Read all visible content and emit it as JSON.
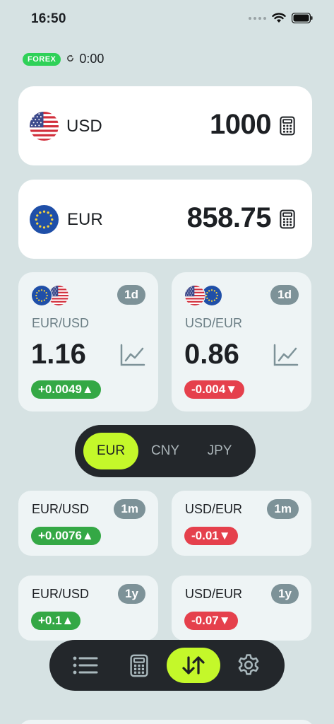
{
  "status_bar": {
    "time": "16:50"
  },
  "source": {
    "badge": "FOREX",
    "timer": "0:00"
  },
  "converter": {
    "from": {
      "code": "USD",
      "amount": "1000"
    },
    "to": {
      "code": "EUR",
      "amount": "858.75"
    }
  },
  "rate_cards": [
    {
      "pair": "EUR/USD",
      "period": "1d",
      "rate": "1.16",
      "change": "+0.0049▲",
      "direction": "up"
    },
    {
      "pair": "USD/EUR",
      "period": "1d",
      "rate": "0.86",
      "change": "-0.004▼",
      "direction": "down"
    }
  ],
  "currency_segment": {
    "options": [
      "EUR",
      "CNY",
      "JPY"
    ],
    "selected": "EUR"
  },
  "history_cards": [
    {
      "pair": "EUR/USD",
      "period": "1m",
      "change": "+0.0076▲",
      "direction": "up"
    },
    {
      "pair": "USD/EUR",
      "period": "1m",
      "change": "-0.01▼",
      "direction": "down"
    },
    {
      "pair": "EUR/USD",
      "period": "1y",
      "change": "+0.1▲",
      "direction": "up"
    },
    {
      "pair": "USD/EUR",
      "period": "1y",
      "change": "-0.07▼",
      "direction": "down"
    }
  ],
  "tab_bar": {
    "items": [
      {
        "icon": "list-icon"
      },
      {
        "icon": "calculator-icon"
      },
      {
        "icon": "swap-arrows-icon",
        "active": true
      },
      {
        "icon": "gear-icon"
      }
    ]
  },
  "colors": {
    "background": "#d6e2e3",
    "accent": "#c4f82a",
    "positive": "#34a845",
    "negative": "#e5404c",
    "forex_badge": "#2fd158",
    "dark": "#23272b",
    "badge": "#7d9298"
  }
}
